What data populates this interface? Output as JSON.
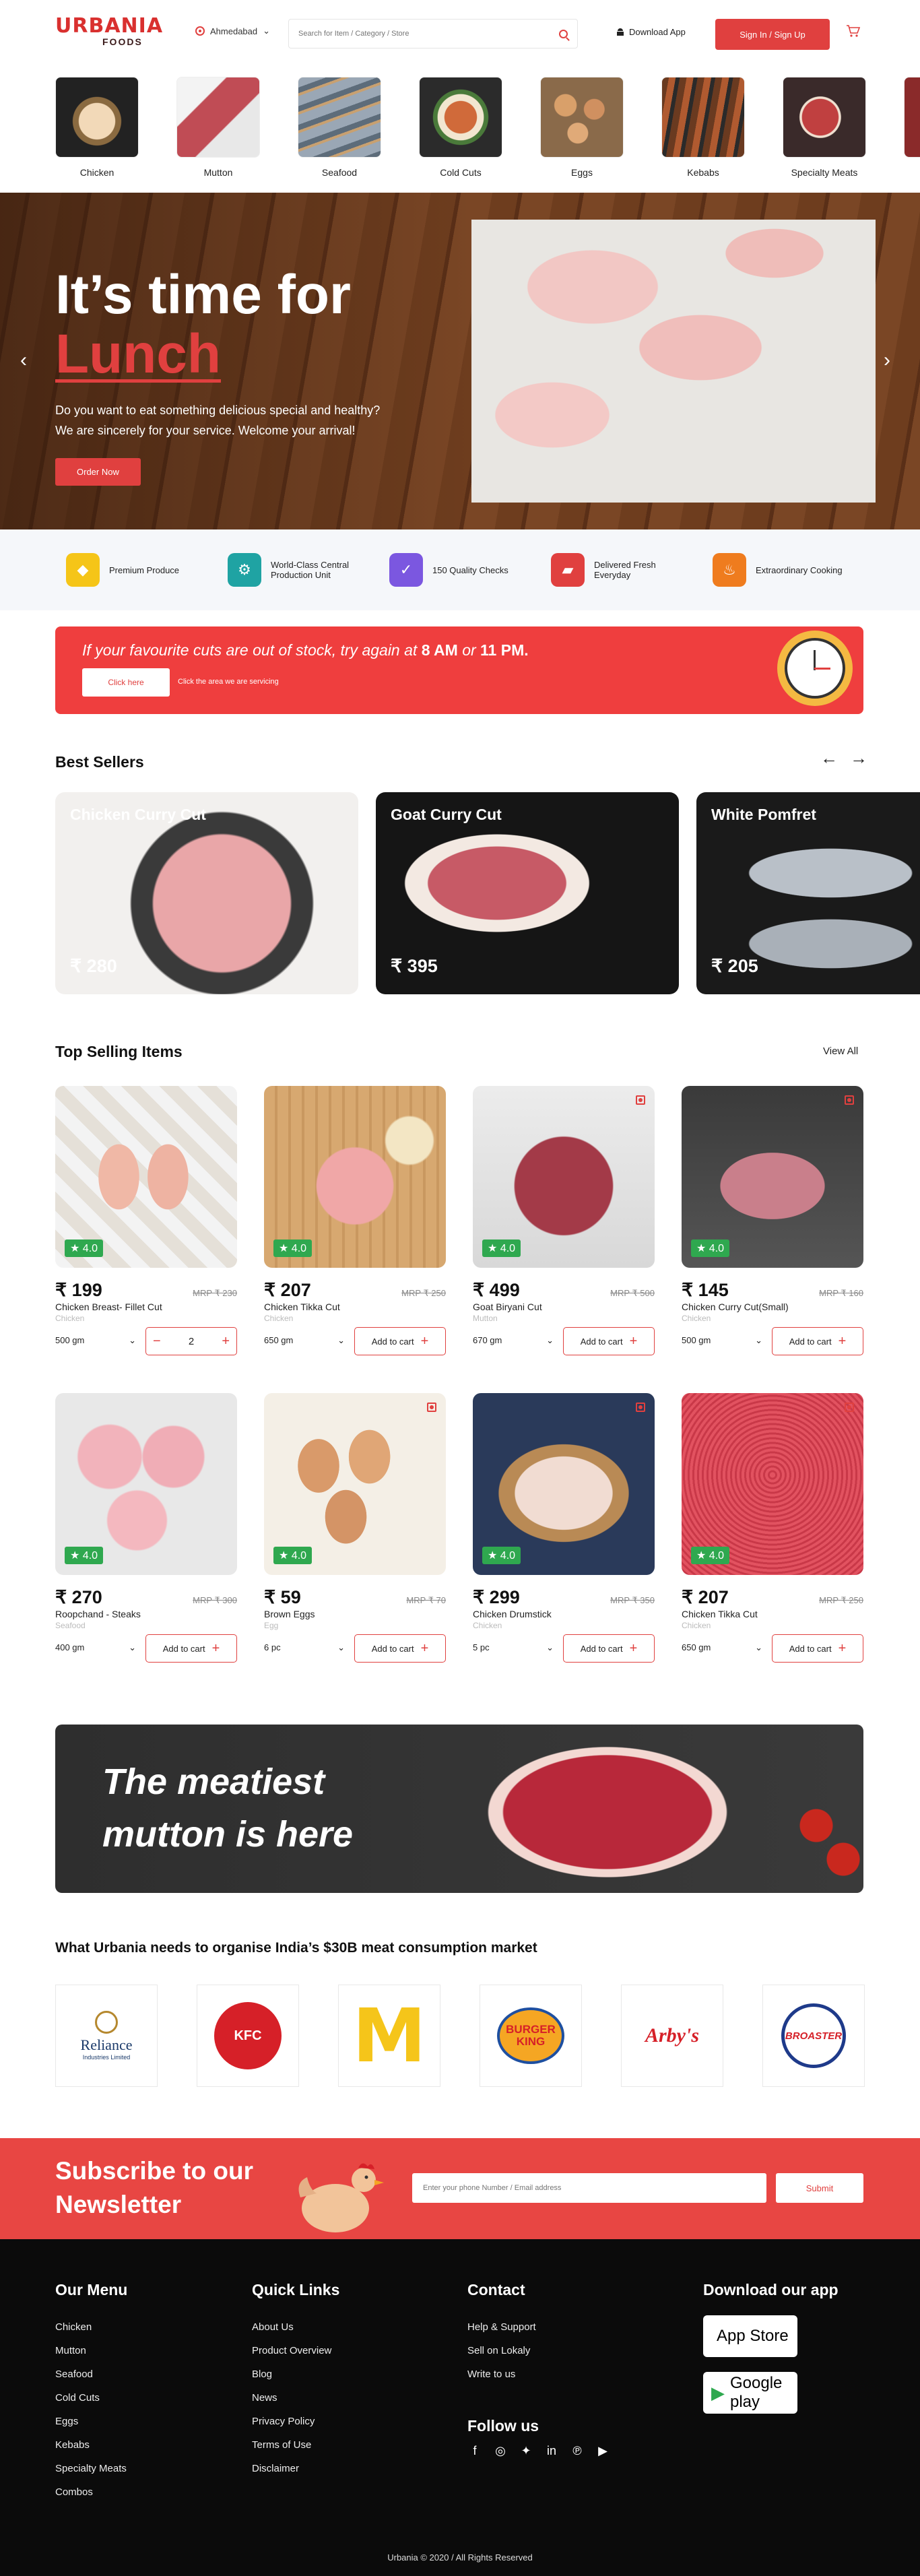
{
  "header": {
    "logo_main": "URBANIA",
    "logo_sub": "FOODS",
    "location": "Ahmedabad",
    "search_placeholder": "Search for Item / Category / Store",
    "download_label": "Download App",
    "signin_label": "Sign In / Sign Up"
  },
  "categories": [
    {
      "label": "Chicken",
      "icon": "chicken-image"
    },
    {
      "label": "Mutton",
      "icon": "mutton-image"
    },
    {
      "label": "Seafood",
      "icon": "seafood-image"
    },
    {
      "label": "Cold Cuts",
      "icon": "coldcuts-image"
    },
    {
      "label": "Eggs",
      "icon": "eggs-image"
    },
    {
      "label": "Kebabs",
      "icon": "kebabs-image"
    },
    {
      "label": "Specialty Meats",
      "icon": "specialty-image"
    }
  ],
  "hero": {
    "line1": "It’s time for",
    "line2": "Lunch",
    "desc1": "Do you want to eat something delicious special and healthy?",
    "desc2": "We are sincerely for your service. Welcome your arrival!",
    "cta": "Order Now"
  },
  "features": [
    {
      "label": "Premium Produce",
      "color": "#f5c518"
    },
    {
      "label": "World-Class Central Production Unit",
      "color": "#1fa3a3"
    },
    {
      "label": "150 Quality Checks",
      "color": "#7b57e0"
    },
    {
      "label": "Delivered Fresh Everyday",
      "color": "#e0403f"
    },
    {
      "label": "Extraordinary Cooking",
      "color": "#ef7c1e"
    }
  ],
  "stock": {
    "prefix": "If your favourite cuts are out of stock, try again at",
    "t1": "8 AM",
    "or": "or",
    "t2": "11 PM.",
    "button": "Click here",
    "sub": "Click the area we are servicing"
  },
  "best_sellers": {
    "title": "Best Sellers",
    "items": [
      {
        "name": "Chicken Curry Cut",
        "price": "₹ 280"
      },
      {
        "name": "Goat Curry Cut",
        "price": "₹ 395"
      },
      {
        "name": "White Pomfret",
        "price": "₹ 205"
      }
    ]
  },
  "top_selling": {
    "title": "Top Selling Items",
    "view_all": "View All",
    "add_label": "Add to cart",
    "items": [
      {
        "rating": "4.0",
        "price": "₹ 199",
        "mrp": "MRP ₹ 230",
        "name": "Chicken Breast- Fillet Cut",
        "cat": "Chicken",
        "weight": "500 gm",
        "qty": "2"
      },
      {
        "rating": "4.0",
        "price": "₹ 207",
        "mrp": "MRP ₹ 250",
        "name": "Chicken Tikka Cut",
        "cat": "Chicken",
        "weight": "650 gm"
      },
      {
        "rating": "4.0",
        "price": "₹ 499",
        "mrp": "MRP ₹ 500",
        "name": "Goat Biryani Cut",
        "cat": "Mutton",
        "weight": "670 gm"
      },
      {
        "rating": "4.0",
        "price": "₹ 145",
        "mrp": "MRP ₹ 160",
        "name": "Chicken Curry Cut(Small)",
        "cat": "Chicken",
        "weight": "500 gm"
      },
      {
        "rating": "4.0",
        "price": "₹ 270",
        "mrp": "MRP ₹ 300",
        "name": "Roopchand - Steaks",
        "cat": "Seafood",
        "weight": "400 gm"
      },
      {
        "rating": "4.0",
        "price": "₹ 59",
        "mrp": "MRP ₹ 70",
        "name": "Brown Eggs",
        "cat": "Egg",
        "weight": "6 pc"
      },
      {
        "rating": "4.0",
        "price": "₹ 299",
        "mrp": "MRP ₹ 350",
        "name": "Chicken Drumstick",
        "cat": "Chicken",
        "weight": "5 pc"
      },
      {
        "rating": "4.0",
        "price": "₹ 207",
        "mrp": "MRP ₹ 250",
        "name": "Chicken Tikka Cut",
        "cat": "Chicken",
        "weight": "650 gm"
      }
    ]
  },
  "mutton_banner": {
    "line1": "The meatiest",
    "line2": "mutton is here"
  },
  "partners": {
    "title": "What Urbania needs to organise India’s $30B meat consumption market",
    "items": [
      {
        "name": "Reliance",
        "sub": "Industries Limited"
      },
      {
        "name": "KFC"
      },
      {
        "name": "M"
      },
      {
        "name": "BURGER KING"
      },
      {
        "name": "Arby's"
      },
      {
        "name": "BROASTER"
      }
    ]
  },
  "newsletter": {
    "title1": "Subscribe to our",
    "title2": "Newsletter",
    "placeholder": "Enter your phone Number / Email address",
    "submit": "Submit"
  },
  "footer": {
    "menu_title": "Our Menu",
    "menu": [
      "Chicken",
      "Mutton",
      "Seafood",
      "Cold Cuts",
      "Eggs",
      "Kebabs",
      "Specialty Meats",
      "Combos"
    ],
    "links_title": "Quick Links",
    "links": [
      "About Us",
      "Product Overview",
      "Blog",
      "News",
      "Privacy Policy",
      "Terms of Use",
      "Disclaimer"
    ],
    "contact_title": "Contact",
    "contact": [
      "Help & Support",
      "Sell on Lokaly",
      "Write to us"
    ],
    "follow_title": "Follow us",
    "app_title": "Download our app",
    "appstore": "App Store",
    "googleplay": "Google play",
    "copyright": "Urbania © 2020 / All Rights Reserved"
  }
}
